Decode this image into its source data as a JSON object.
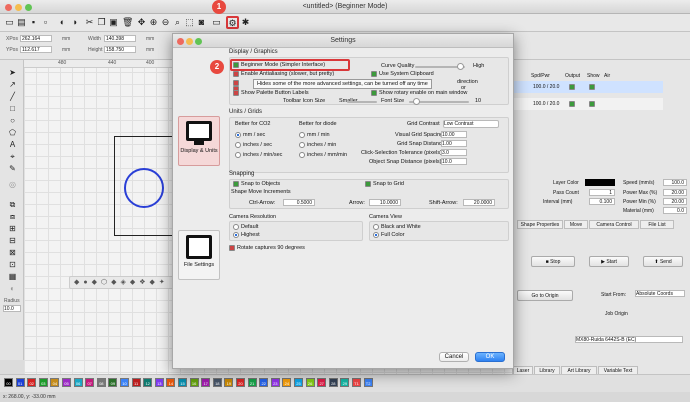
{
  "window": {
    "title": "<untitled> (Beginner Mode)"
  },
  "propbar": {
    "xpos_label": "XPos",
    "xpos": "262.164",
    "ypos_label": "YPos",
    "ypos": "112.617",
    "width_label": "Width",
    "width": "140.398",
    "height_label": "Height",
    "height": "158.750",
    "unit": "mm"
  },
  "ruler": {
    "top": [
      "480",
      "440",
      "400",
      "360",
      "320",
      "280"
    ]
  },
  "dialog": {
    "title": "Settings",
    "display_graphics": "Display / Graphics",
    "beginner_mode": "Beginner Mode (Simpler Interface)",
    "enable_antialiasing": "Enable Antialiasing (slower, but pretty)",
    "use_system_clipboard": "Use System Clipboard",
    "show_palette_labels": "Show Palette Button Labels",
    "show_rotary": "Show rotary enable on main window",
    "direction_tail": "direction",
    "or_tail": "or",
    "tooltip": "Hides some of the more advanced settings, can be turned off any time",
    "curve_quality": "Curve Quality",
    "high": "High",
    "toolbar_icon_size": "Toolbar Icon Size",
    "smaller": "Smaller",
    "font_size": "Font Size",
    "font_size_value": "10",
    "units_grids": "Units / Grids",
    "better_co2": "Better for CO2",
    "better_diode": "Better for diode",
    "co2_units": [
      "mm / sec",
      "inches / sec",
      "inches / min/sec"
    ],
    "diode_units": [
      "mm / min",
      "inches / min",
      "inches / mm/min"
    ],
    "grid_contrast": "Grid Contrast",
    "grid_contrast_value": "Low Contrast",
    "visual_grid_spacing": "Visual Grid Spacing",
    "visual_grid_spacing_value": "10.00",
    "grid_snap_distance": "Grid Snap Distance",
    "grid_snap_distance_value": "1.00",
    "click_selection_tolerance": "Click-Selection Tolerance (pixels)",
    "click_selection_tolerance_value": "3.0",
    "object_snap_distance": "Object Snap Distance (pixels)",
    "object_snap_distance_value": "10.0",
    "snapping": "Snapping",
    "snap_to_objects": "Snap to Objects",
    "snap_to_grid": "Snap to Grid",
    "shape_move_increments": "Shape Move Increments",
    "ctrl_arrow": "Ctrl-Arrow:",
    "ctrl_arrow_value": "0.5000",
    "arrow": "Arrow:",
    "arrow_value": "10.0000",
    "shift_arrow": "Shift-Arrow:",
    "shift_arrow_value": "20.0000",
    "camera_resolution": "Camera Resolution",
    "cam_res_default": "Default",
    "cam_res_highest": "Highest",
    "camera_view": "Camera View",
    "cam_view_bw": "Black and White",
    "cam_view_color": "Full Color",
    "rotate_captures": "Rotate captures 90 degrees",
    "side_display": "Display & Units",
    "side_file": "File Settings",
    "cancel": "Cancel",
    "ok": "OK"
  },
  "callouts": {
    "one": "1",
    "two": "2"
  },
  "rightpanel": {
    "headers": [
      "Spd/Pwr",
      "Output",
      "Show",
      "Air"
    ],
    "rows": [
      {
        "value": "100.0 / 20.0"
      },
      {
        "value": "100.0 / 20.0"
      }
    ],
    "layer_color": "Layer Color",
    "passes_count": "Pass Count",
    "passes_value": "1",
    "interval": "Interval (mm)",
    "interval_value": "0.100",
    "speed": "Speed (mm/s)",
    "speed_value": "100.0",
    "power_max": "Power Max (%)",
    "power_max_value": "20.00",
    "power_min": "Power Min (%)",
    "power_min_value": "20.00",
    "material": "Material (mm)",
    "material_value": "0.0",
    "tabs": [
      "Shape Properties",
      "Move",
      "Camera Control",
      "File List"
    ],
    "stop": "Stop",
    "start": "Start",
    "send": "Send",
    "go_to_origin": "Go to Origin",
    "start_from": "Start From:",
    "start_from_value": "Absolute Coords",
    "job_origin": "Job Origin",
    "device": "MX80-Ruida 6442S-B (EC)",
    "bottom_tabs": [
      "Laser",
      "Library",
      "Art Library",
      "Variable Text"
    ]
  },
  "radius_label": "Radius",
  "radius_value": "10.0",
  "palette": [
    "00",
    "01",
    "02",
    "03",
    "04",
    "05",
    "06",
    "07",
    "08",
    "09",
    "10",
    "11",
    "12",
    "13",
    "14",
    "15",
    "16",
    "17",
    "18",
    "19",
    "20",
    "21",
    "22",
    "23",
    "24",
    "25",
    "26",
    "27",
    "28",
    "29",
    "T1",
    "T2"
  ],
  "palette_colors": [
    "#000000",
    "#1a3fd6",
    "#d62020",
    "#1c9b2a",
    "#c48b1a",
    "#9b2ac4",
    "#1aa7c4",
    "#c41a7c",
    "#777777",
    "#2a6f2a",
    "#3b82f6",
    "#b91c1c",
    "#0d7a6f",
    "#7c3aed",
    "#ea580c",
    "#0891b2",
    "#65a30d",
    "#a21caf",
    "#475569",
    "#ca8a04",
    "#dc2626",
    "#16a34a",
    "#2563eb",
    "#9333ea",
    "#f59e0b",
    "#0ea5e9",
    "#84cc16",
    "#e11d48",
    "#334155",
    "#14b8a6",
    "#ef4444",
    "#3b82f6"
  ],
  "status": "x: 268.00, y: -33.00 mm",
  "accent": "#d9383a"
}
